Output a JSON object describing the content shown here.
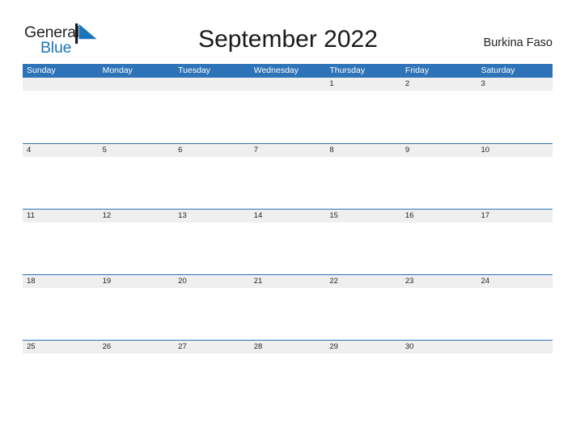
{
  "brand": {
    "word_one": "General",
    "word_two": "Blue",
    "flag_icon": "blue-flag-triangle-icon",
    "text_color": "#231f20",
    "accent_color": "#1b75bb"
  },
  "header": {
    "title": "September 2022",
    "region": "Burkina Faso"
  },
  "theme": {
    "header_blue": "#2e73b8",
    "row_divider_blue": "#2e73b8",
    "day_strip_gray": "#efefef",
    "page_background": "#ffffff",
    "text_color": "#231f20"
  },
  "calendar": {
    "month": "September",
    "year": "2022",
    "weekdays": [
      "Sunday",
      "Monday",
      "Tuesday",
      "Wednesday",
      "Thursday",
      "Friday",
      "Saturday"
    ],
    "weeks": [
      [
        "",
        "",
        "",
        "",
        "1",
        "2",
        "3"
      ],
      [
        "4",
        "5",
        "6",
        "7",
        "8",
        "9",
        "10"
      ],
      [
        "11",
        "12",
        "13",
        "14",
        "15",
        "16",
        "17"
      ],
      [
        "18",
        "19",
        "20",
        "21",
        "22",
        "23",
        "24"
      ],
      [
        "25",
        "26",
        "27",
        "28",
        "29",
        "30",
        ""
      ]
    ]
  }
}
